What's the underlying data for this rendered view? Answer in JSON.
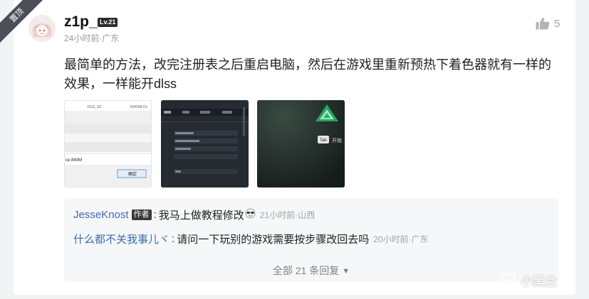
{
  "pin_label": "置顶",
  "comment": {
    "username": "z1p_",
    "level": "Lv.21",
    "time_location": "24小时前·广东",
    "like_count": "5",
    "text": "最简单的方法，改完注册表之后重启电脑，然后在游戏里重新预热下着色器就有一样的效果，一样能开dlss"
  },
  "thumbnails": [
    {
      "name": "registry-screenshot",
      "texts": [
        "DLG_S2",
        "NVIDIA Co",
        "ce 840M",
        "确定"
      ]
    },
    {
      "name": "game-settings-screenshot",
      "texts": []
    },
    {
      "name": "game-scene-screenshot",
      "texts": [
        "Tab",
        "开始"
      ]
    }
  ],
  "replies": [
    {
      "name": "JesseKnost",
      "tag": "作者",
      "text": "我马上做教程修改",
      "meta": "21小时前·山西"
    },
    {
      "name": "什么都不关我事儿ヾ",
      "text": "请问一下玩别的游戏需要按步骤改回去吗",
      "meta": "20小时前·广东"
    }
  ],
  "all_replies_label": "全部 21 条回复",
  "watermark": "小黑盒",
  "icons": [
    "thumbs-up-icon",
    "chevron-down-icon",
    "sunglasses-emoji-icon",
    "heybox-logo-icon"
  ]
}
